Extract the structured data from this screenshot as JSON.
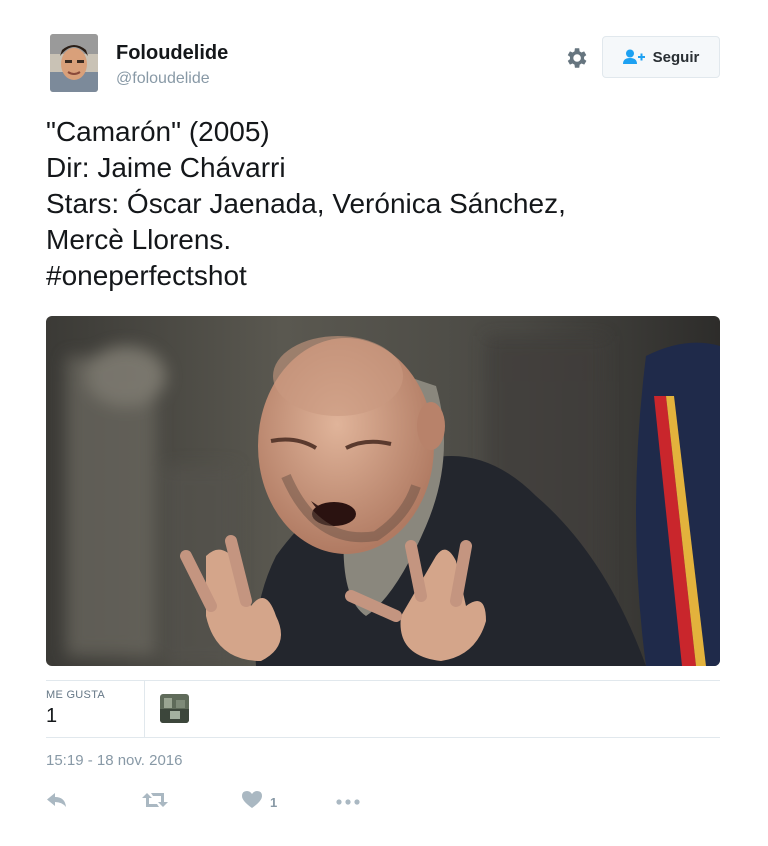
{
  "author": {
    "display_name": "Foloudelide",
    "handle": "@foloudelide",
    "avatar_icon": "profile-photo"
  },
  "header": {
    "settings_icon": "gear-icon",
    "follow_label": "Seguir",
    "follow_icon": "add-user-icon"
  },
  "tweet": {
    "lines": [
      "\"Camarón\" (2005)",
      "Dir: Jaime Chávarri",
      "Stars: Óscar Jaenada, Verónica Sánchez,",
      "Mercè Llorens.",
      "#oneperfectshot"
    ],
    "media_icon": "photo"
  },
  "stats": {
    "likes_label": "ME GUSTA",
    "likes_count": "1"
  },
  "timestamp": "15:19 - 18 nov. 2016",
  "actions": {
    "reply_icon": "reply-icon",
    "retweet_icon": "retweet-icon",
    "like_icon": "heart-icon",
    "like_count": "1",
    "more_icon": "more-icon"
  },
  "colors": {
    "muted": "#8899a6",
    "border": "#e1e8ed",
    "action_icon": "#aab8c2",
    "follow_icon": "#1da1f2"
  }
}
